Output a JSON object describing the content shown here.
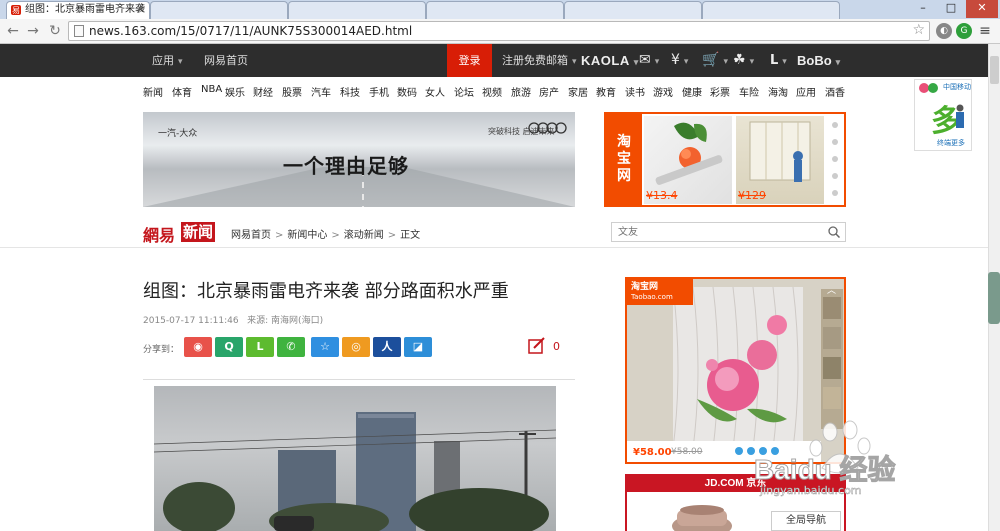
{
  "browser": {
    "active_tab_title": "组图：北京暴雨雷电齐来袭",
    "url": "news.163.com/15/0717/11/AUNK75S300014AED.html",
    "window_buttons": {
      "minimize": "–",
      "maximize": "□",
      "close": "✕"
    }
  },
  "topnav": {
    "apps": "应用",
    "home": "网易首页",
    "login": "登录",
    "free_mail": "注册免费邮箱",
    "kaola": "KAOLA",
    "bobo": "BoBo",
    "l_label": "L"
  },
  "channels": [
    "新闻",
    "体育",
    "NBA",
    "娱乐",
    "财经",
    "股票",
    "汽车",
    "科技",
    "手机",
    "数码",
    "女人",
    "论坛",
    "视频",
    "旅游",
    "房产",
    "家居",
    "教育",
    "读书",
    "游戏",
    "健康",
    "彩票",
    "车险",
    "海淘",
    "应用",
    "酒香"
  ],
  "ads": {
    "audi_slogan": "一个理由足够",
    "audi_brand_left": "一汽-大众",
    "audi_brand_right": "突破科技 启迪未来",
    "taobao_logo": "淘宝网",
    "taobao_price_1": "¥13.4",
    "taobao_price_2": "¥129",
    "china_mobile": "中国移动",
    "cm_big": "多",
    "cm_small": "终端更多",
    "taobao2_logo": "淘宝网",
    "taobao2_sub": "Taobao.com",
    "taobao2_price_now": "¥58.00",
    "taobao2_price_old": "¥58.00",
    "jd_logo": "JD.COM 京东"
  },
  "site": {
    "logo_left": "網易",
    "logo_right": "新闻",
    "breadcrumb": [
      "网易首页",
      "新闻中心",
      "滚动新闻",
      "正文"
    ],
    "search_placeholder": "文友"
  },
  "article": {
    "title": "组图：北京暴雨雷电齐来袭  部分路面积水严重",
    "meta": "2015-07-17 11:11:46   来源: 南海网(海口)",
    "share_label": "分享到：",
    "comment_count": "0"
  },
  "watermark": {
    "brand": "Baidu 经验",
    "url": "jingyan.baidu.com"
  },
  "global_nav": "全局导航",
  "colors": {
    "accent_red": "#d81e06",
    "taobao_orange": "#f24c00",
    "jd_red": "#c91623",
    "topnav_bg": "#2d2d2d"
  }
}
